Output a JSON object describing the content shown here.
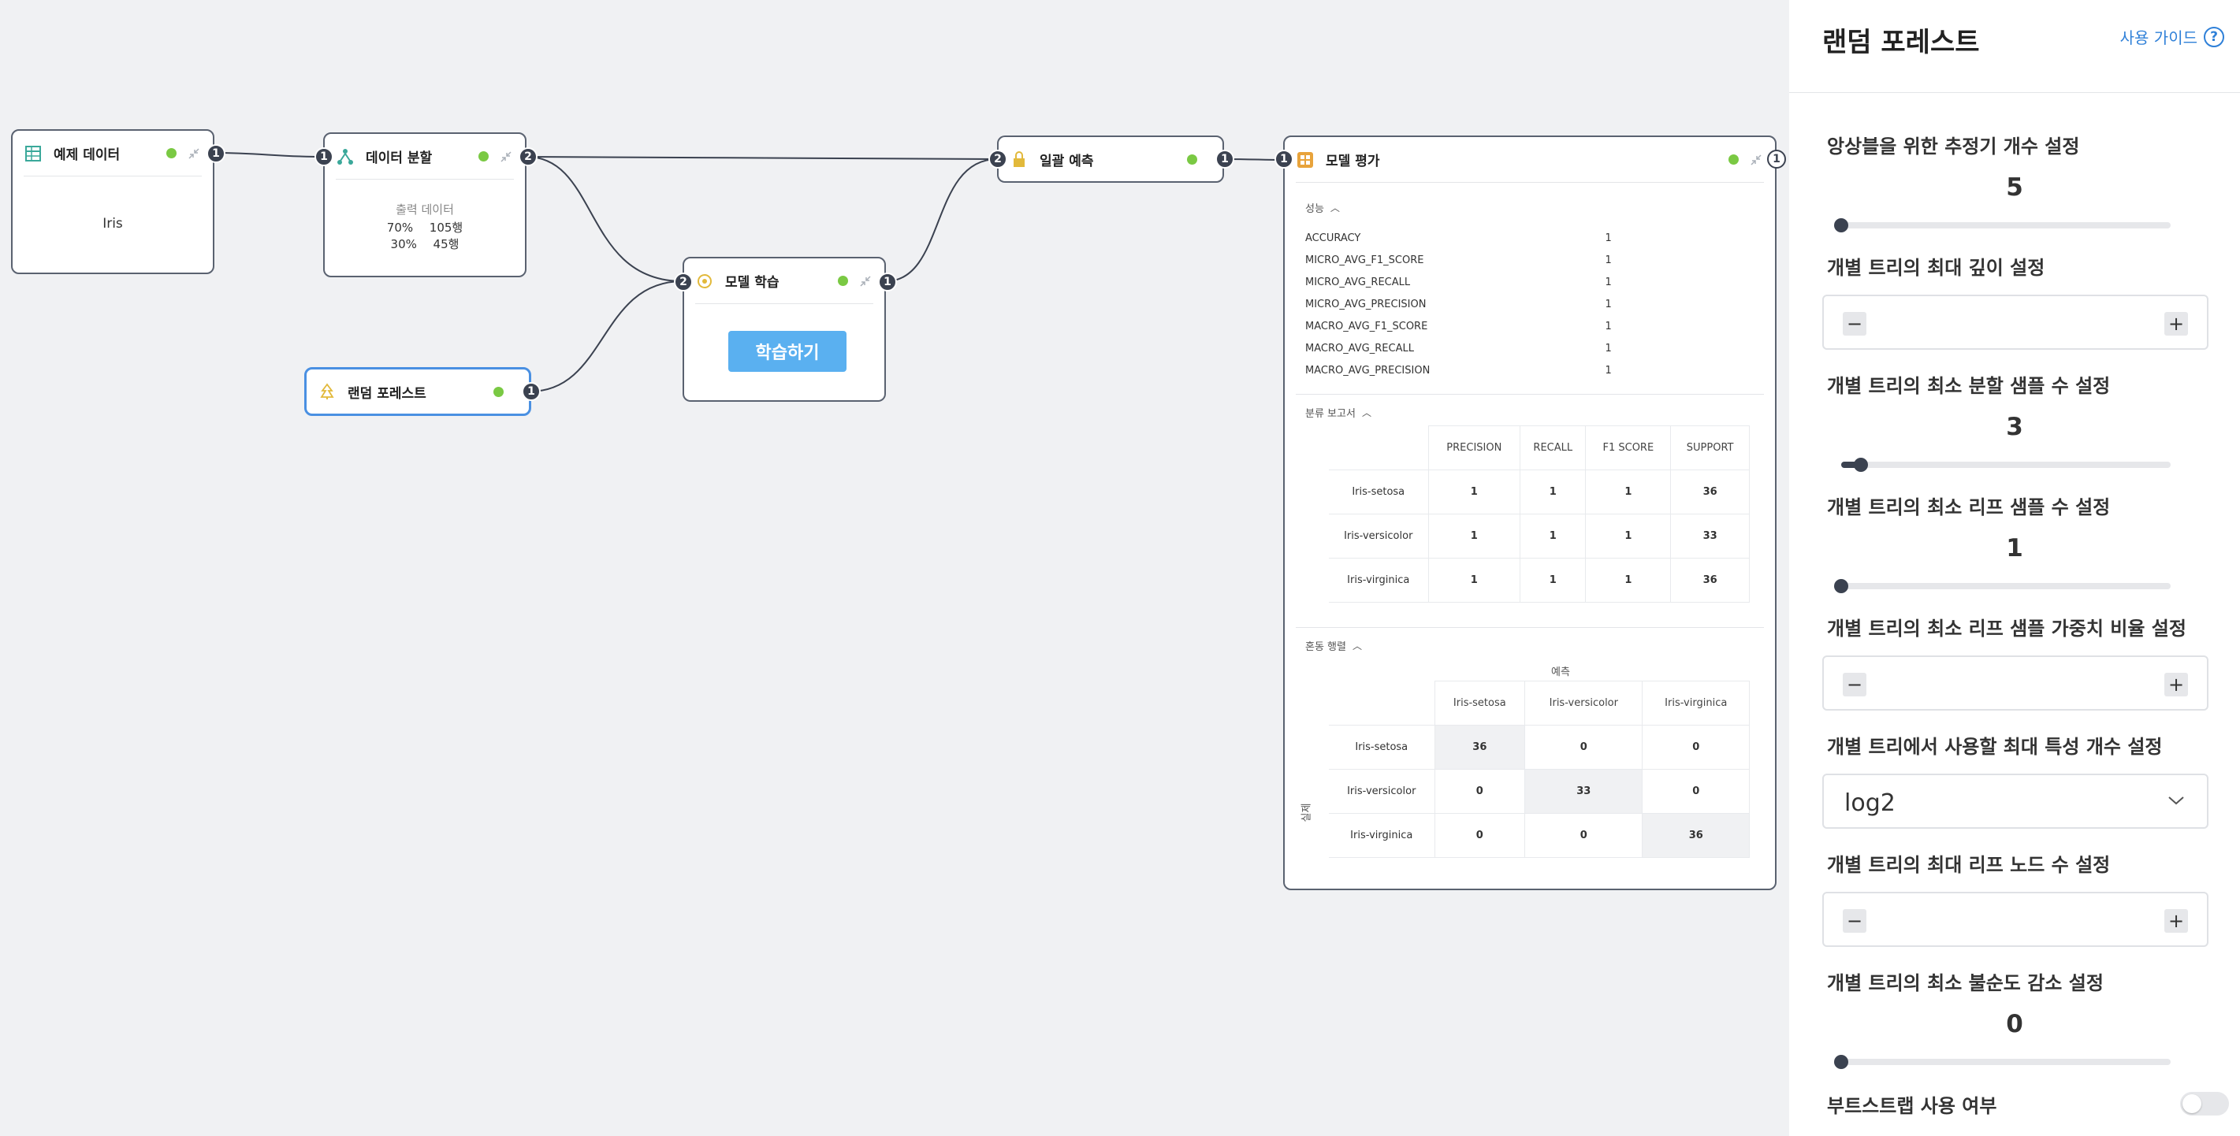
{
  "colors": {
    "accent": "#4a90e2",
    "status_ok": "#7ac943",
    "port": "#3b4250",
    "button": "#5ab0f0"
  },
  "nodes": {
    "sample_data": {
      "title": "예제 데이터",
      "content": "Iris",
      "port_out": "1",
      "icon": "table-icon"
    },
    "data_split": {
      "title": "데이터 분할",
      "icon": "split-icon",
      "port_in": "1",
      "port_out": "2",
      "output_label": "출력 데이터",
      "rows": [
        {
          "pct": "70%",
          "count": "105행"
        },
        {
          "pct": "30%",
          "count": "45행"
        }
      ]
    },
    "random_forest": {
      "title": "랜덤 포레스트",
      "icon": "tree-icon",
      "port_out": "1"
    },
    "model_train": {
      "title": "모델 학습",
      "icon": "gear-icon",
      "port_in": "2",
      "port_out": "1",
      "button": "학습하기"
    },
    "batch_predict": {
      "title": "일괄 예측",
      "icon": "lock-icon",
      "port_in": "2",
      "port_out": "1"
    },
    "model_eval": {
      "title": "모델 평가",
      "icon": "grid-icon",
      "port_in": "1",
      "port_out": "1",
      "perf_title": "성능",
      "metrics": [
        {
          "name": "ACCURACY",
          "value": "1"
        },
        {
          "name": "MICRO_AVG_F1_SCORE",
          "value": "1"
        },
        {
          "name": "MICRO_AVG_RECALL",
          "value": "1"
        },
        {
          "name": "MICRO_AVG_PRECISION",
          "value": "1"
        },
        {
          "name": "MACRO_AVG_F1_SCORE",
          "value": "1"
        },
        {
          "name": "MACRO_AVG_RECALL",
          "value": "1"
        },
        {
          "name": "MACRO_AVG_PRECISION",
          "value": "1"
        }
      ],
      "report_title": "분류 보고서",
      "report_headers": [
        "PRECISION",
        "RECALL",
        "F1 SCORE",
        "SUPPORT"
      ],
      "report_rows": [
        {
          "label": "Iris-setosa",
          "values": [
            "1",
            "1",
            "1",
            "36"
          ]
        },
        {
          "label": "Iris-versicolor",
          "values": [
            "1",
            "1",
            "1",
            "33"
          ]
        },
        {
          "label": "Iris-virginica",
          "values": [
            "1",
            "1",
            "1",
            "36"
          ]
        }
      ],
      "confusion_title": "혼동 행렬",
      "confusion_pred_label": "예측",
      "confusion_actual_label": "실제",
      "confusion_headers": [
        "Iris-setosa",
        "Iris-versicolor",
        "Iris-virginica"
      ],
      "confusion_rows": [
        {
          "label": "Iris-setosa",
          "values": [
            "36",
            "0",
            "0"
          ]
        },
        {
          "label": "Iris-versicolor",
          "values": [
            "0",
            "33",
            "0"
          ]
        },
        {
          "label": "Iris-virginica",
          "values": [
            "0",
            "0",
            "36"
          ]
        }
      ]
    }
  },
  "panel": {
    "title": "랜덤 포레스트",
    "guide_label": "사용 가이드",
    "settings": [
      {
        "label": "앙상블을 위한 추정기 개수 설정",
        "type": "slider",
        "value": "5",
        "fraction": 0.0
      },
      {
        "label": "개별 트리의 최대 깊이 설정",
        "type": "stepper",
        "minus": "−",
        "plus": "+"
      },
      {
        "label": "개별 트리의 최소 분할 샘플 수 설정",
        "type": "slider",
        "value": "3",
        "fraction": 0.06
      },
      {
        "label": "개별 트리의 최소 리프 샘플 수 설정",
        "type": "slider",
        "value": "1",
        "fraction": 0.0
      },
      {
        "label": "개별 트리의 최소 리프 샘플 가중치 비율 설정",
        "type": "stepper",
        "minus": "−",
        "plus": "+"
      },
      {
        "label": "개별 트리에서 사용할 최대 특성 개수 설정",
        "type": "select",
        "value": "log2"
      },
      {
        "label": "개별 트리의 최대 리프 노드 수 설정",
        "type": "stepper",
        "minus": "−",
        "plus": "+"
      },
      {
        "label": "개별 트리의 최소 불순도 감소 설정",
        "type": "slider",
        "value": "0",
        "fraction": 0.0
      },
      {
        "label": "부트스트랩 사용 여부",
        "type": "toggle",
        "enabled": false
      }
    ]
  }
}
